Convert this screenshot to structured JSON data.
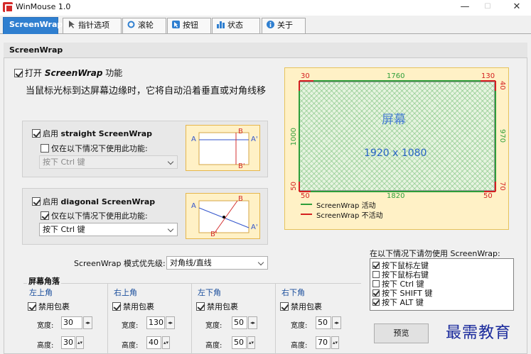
{
  "window": {
    "title": "WinMouse 1.0",
    "min": "—",
    "max": "☐",
    "close": "✕"
  },
  "tabs": [
    {
      "label": "ScreenWrap",
      "icon": "none"
    },
    {
      "label": "指针选项",
      "icon": "pointer-icon"
    },
    {
      "label": "滚轮",
      "icon": "wheel-icon"
    },
    {
      "label": "按钮",
      "icon": "button-icon"
    },
    {
      "label": "状态",
      "icon": "chart-icon"
    },
    {
      "label": "关于",
      "icon": "info-icon"
    }
  ],
  "section": {
    "title": "ScreenWrap"
  },
  "enable": {
    "label_prefix": "打开 ",
    "label_bold": "ScreenWrap",
    "label_suffix": " 功能",
    "checked": true
  },
  "description": "当鼠标光标到达屏幕边缘时，它将自动沿着垂直或对角线移",
  "straight": {
    "label_prefix": "启用 ",
    "label_bold": "straight ScreenWrap",
    "checked": true,
    "only_label": "仅在以下情况下使用此功能:",
    "only_checked": false,
    "key_value": "按下 Ctrl 键",
    "disabled": true,
    "diagram": {
      "a": "A",
      "a2": "A'",
      "b": "B",
      "b2": "B'"
    }
  },
  "diagonal": {
    "label_prefix": "启用 ",
    "label_bold": "diagonal ScreenWrap",
    "checked": true,
    "only_label": "仅在以下情况下使用此功能:",
    "only_checked": true,
    "key_value": "按下 Ctrl 键",
    "disabled": false,
    "diagram": {
      "a": "A",
      "a2": "A'",
      "b": "B",
      "b2": "B'"
    }
  },
  "preview_map": {
    "top_left": "30",
    "top": "1760",
    "top_right": "130",
    "right_top": "40",
    "right": "970",
    "right_bottom": "70",
    "left_top": "",
    "left": "1000",
    "left_bottom": "50",
    "bottom_left": "50",
    "bottom": "1820",
    "bottom_right": "50",
    "screen_label": "屏幕",
    "resolution": "1920 x 1080",
    "legend_active": "ScreenWrap 活动",
    "legend_inactive": "ScreenWrap 不活动",
    "active_color": "#2e9e3a",
    "inactive_color": "#d42020"
  },
  "priority": {
    "label": "ScreenWrap 模式优先级:",
    "value": "对角线/直线"
  },
  "exceptions": {
    "title": "在以下情况下请勿使用 ScreenWrap:",
    "items": [
      {
        "label": "按下鼠标左键",
        "checked": true
      },
      {
        "label": "按下鼠标右键",
        "checked": false
      },
      {
        "label": "按下 Ctrl 键",
        "checked": false
      },
      {
        "label": "按下 SHIFT 键",
        "checked": true
      },
      {
        "label": "按下 ALT 键",
        "checked": true
      }
    ]
  },
  "corners": {
    "title": "屏幕角落",
    "width_label": "宽度:",
    "height_label": "高度:",
    "disable_label": "禁用包裹",
    "items": [
      {
        "name": "左上角",
        "disabled": true,
        "width": "30",
        "height": "30"
      },
      {
        "name": "右上角",
        "disabled": true,
        "width": "130",
        "height": "40"
      },
      {
        "name": "左下角",
        "disabled": true,
        "width": "50",
        "height": "50"
      },
      {
        "name": "右下角",
        "disabled": true,
        "width": "50",
        "height": "70"
      }
    ]
  },
  "preview_button": "预览",
  "watermark": "最需教育"
}
